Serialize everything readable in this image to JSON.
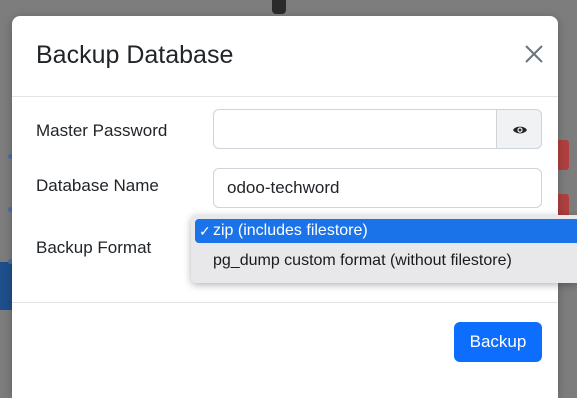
{
  "modal": {
    "title": "Backup Database",
    "close_icon": "close-icon"
  },
  "form": {
    "master_password": {
      "label": "Master Password",
      "value": "",
      "toggle_icon": "eye-icon"
    },
    "database_name": {
      "label": "Database Name",
      "value": "odoo-techword"
    },
    "backup_format": {
      "label": "Backup Format",
      "selected": "zip (includes filestore)",
      "options": [
        {
          "check": "✓",
          "label": "zip (includes filestore)"
        },
        {
          "check": "",
          "label": "pg_dump custom format (without filestore)"
        }
      ]
    }
  },
  "footer": {
    "backup_label": "Backup"
  },
  "colors": {
    "primary": "#0d6efd",
    "option_highlight": "#1a73e8",
    "overlay": "#7d7d7d"
  }
}
